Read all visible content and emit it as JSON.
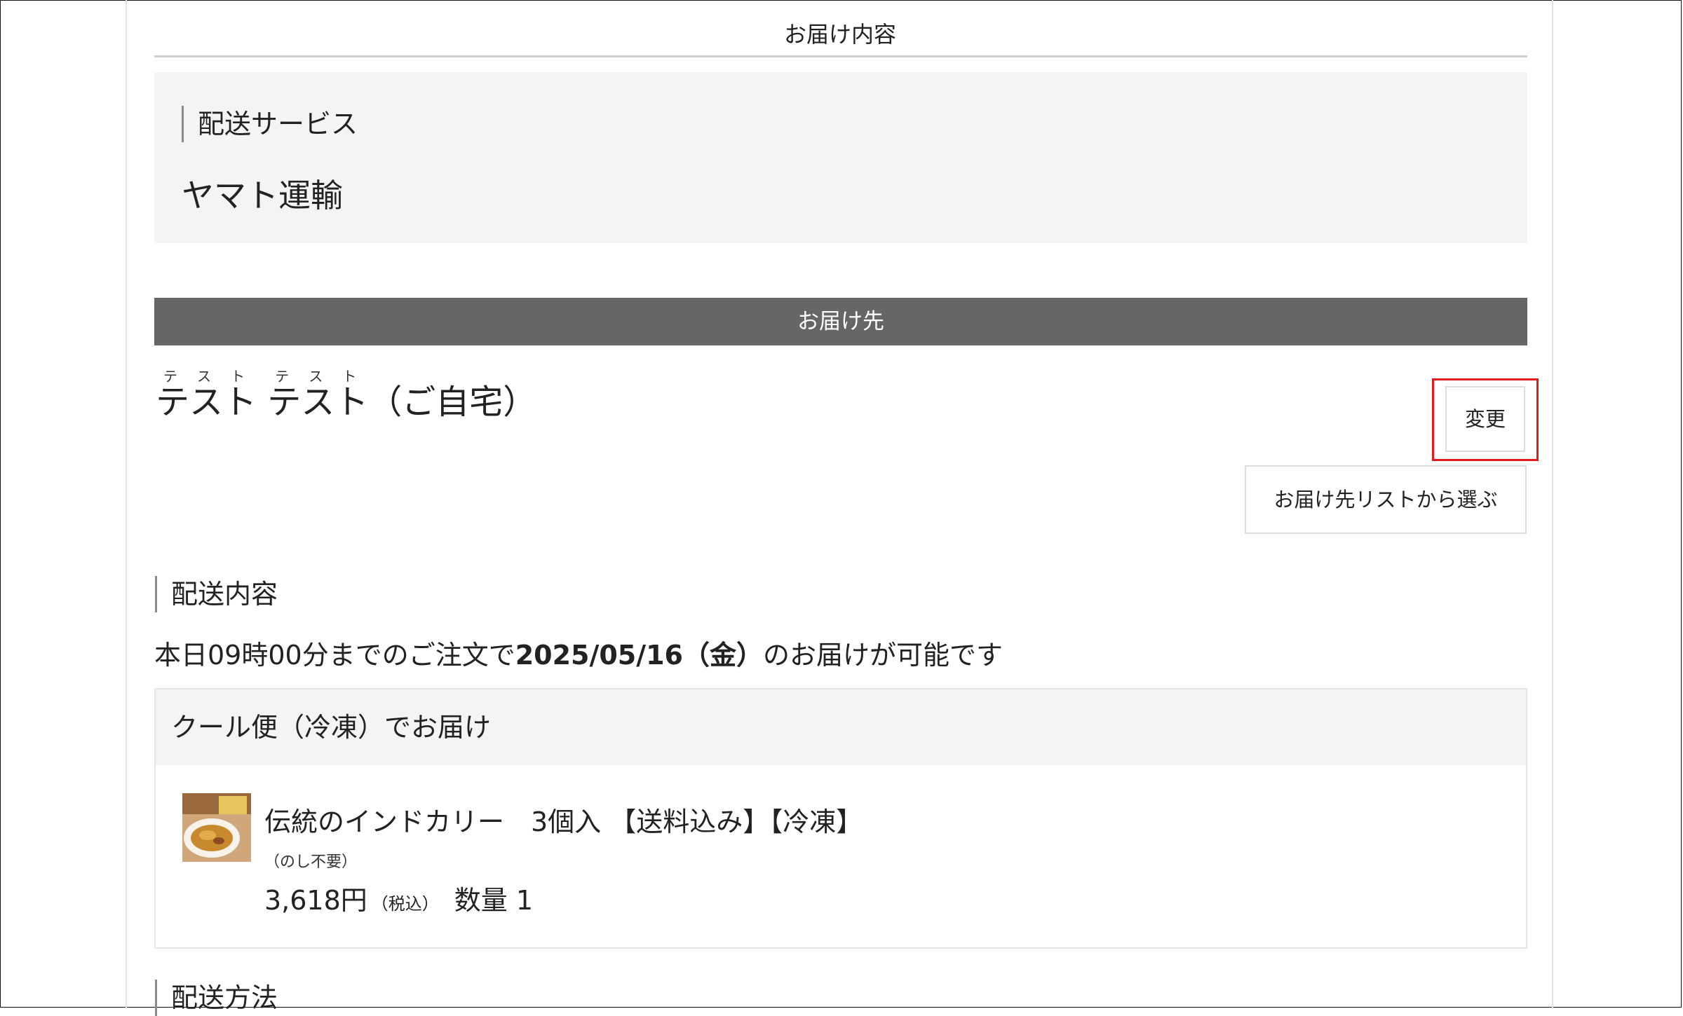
{
  "tab": {
    "title": "お届け内容"
  },
  "delivery_service": {
    "label": "配送サービス",
    "value": "ヤマト運輸"
  },
  "destination": {
    "header": "お届け先",
    "name_kana_1": "テスト",
    "name_1": "テスト",
    "name_kana_2": "テスト",
    "name_2": "テスト",
    "suffix": "（ご自宅）",
    "change_button": "変更",
    "list_button": "お届け先リストから選ぶ"
  },
  "delivery_content": {
    "label": "配送内容",
    "availability_prefix": "本日09時00分までのご注文で",
    "availability_date": "2025/05/16（金）",
    "availability_suffix": "のお届けが可能です",
    "shipping_type": "クール便（冷凍）でお届け",
    "item": {
      "image": "curry-plate-thumbnail",
      "name": "伝統のインドカリー　3個入 【送料込み】【冷凍】",
      "note": "（のし不要）",
      "price": "3,618円",
      "tax": "（税込）",
      "quantity": "数量 1"
    }
  },
  "delivery_method": {
    "label": "配送方法"
  }
}
